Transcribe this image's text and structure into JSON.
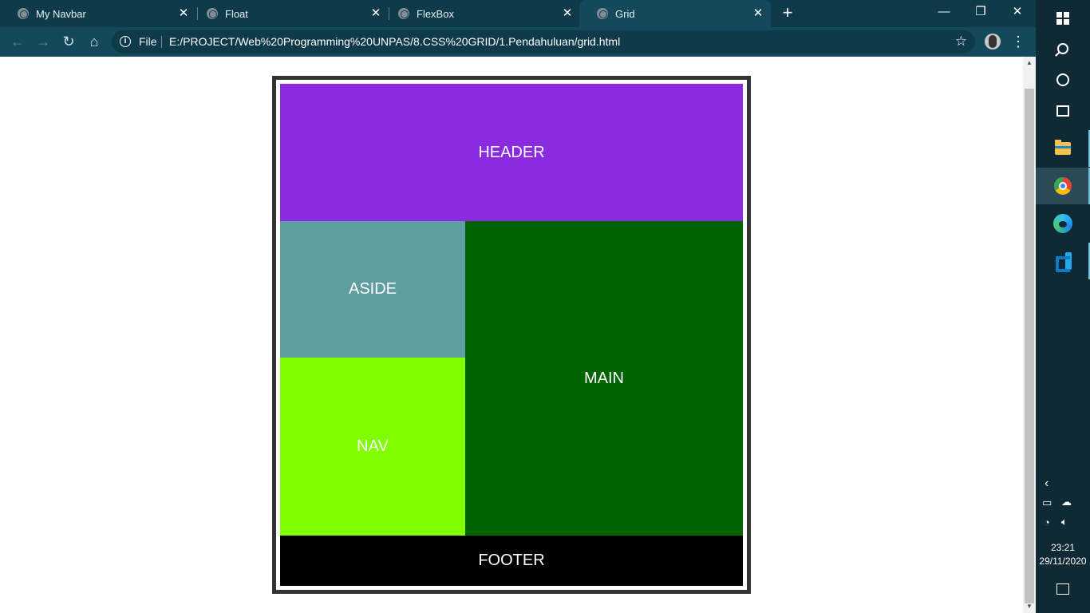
{
  "browser": {
    "tabs": [
      {
        "label": "My Navbar",
        "active": false
      },
      {
        "label": "Float",
        "active": false
      },
      {
        "label": "FlexBox",
        "active": false
      },
      {
        "label": "Grid",
        "active": true
      }
    ],
    "new_tab_label": "+",
    "window_controls": {
      "minimize": "—",
      "restore": "❐",
      "close": "✕"
    },
    "toolbar": {
      "back_icon": "←",
      "forward_icon": "→",
      "reload_icon": "↻",
      "home_icon": "⌂",
      "scheme_label": "File",
      "url": "E:/PROJECT/Web%20Programming%20UNPAS/8.CSS%20GRID/1.Pendahuluan/grid.html",
      "bookmark_icon": "☆",
      "menu_icon": "⋮"
    }
  },
  "page": {
    "header": "HEADER",
    "aside": "ASIDE",
    "nav": "NAV",
    "main": "MAIN",
    "footer": "FOOTER",
    "colors": {
      "header": "#8a2be2",
      "aside": "#5f9ea0",
      "nav": "#7fff00",
      "main": "#006400",
      "footer": "#000000"
    }
  },
  "taskbar": {
    "apps": [
      "start",
      "search",
      "cortana",
      "task-view",
      "file-explorer",
      "chrome",
      "edge",
      "vscode"
    ],
    "tray": {
      "time": "23:21",
      "date": "29/11/2020"
    }
  }
}
